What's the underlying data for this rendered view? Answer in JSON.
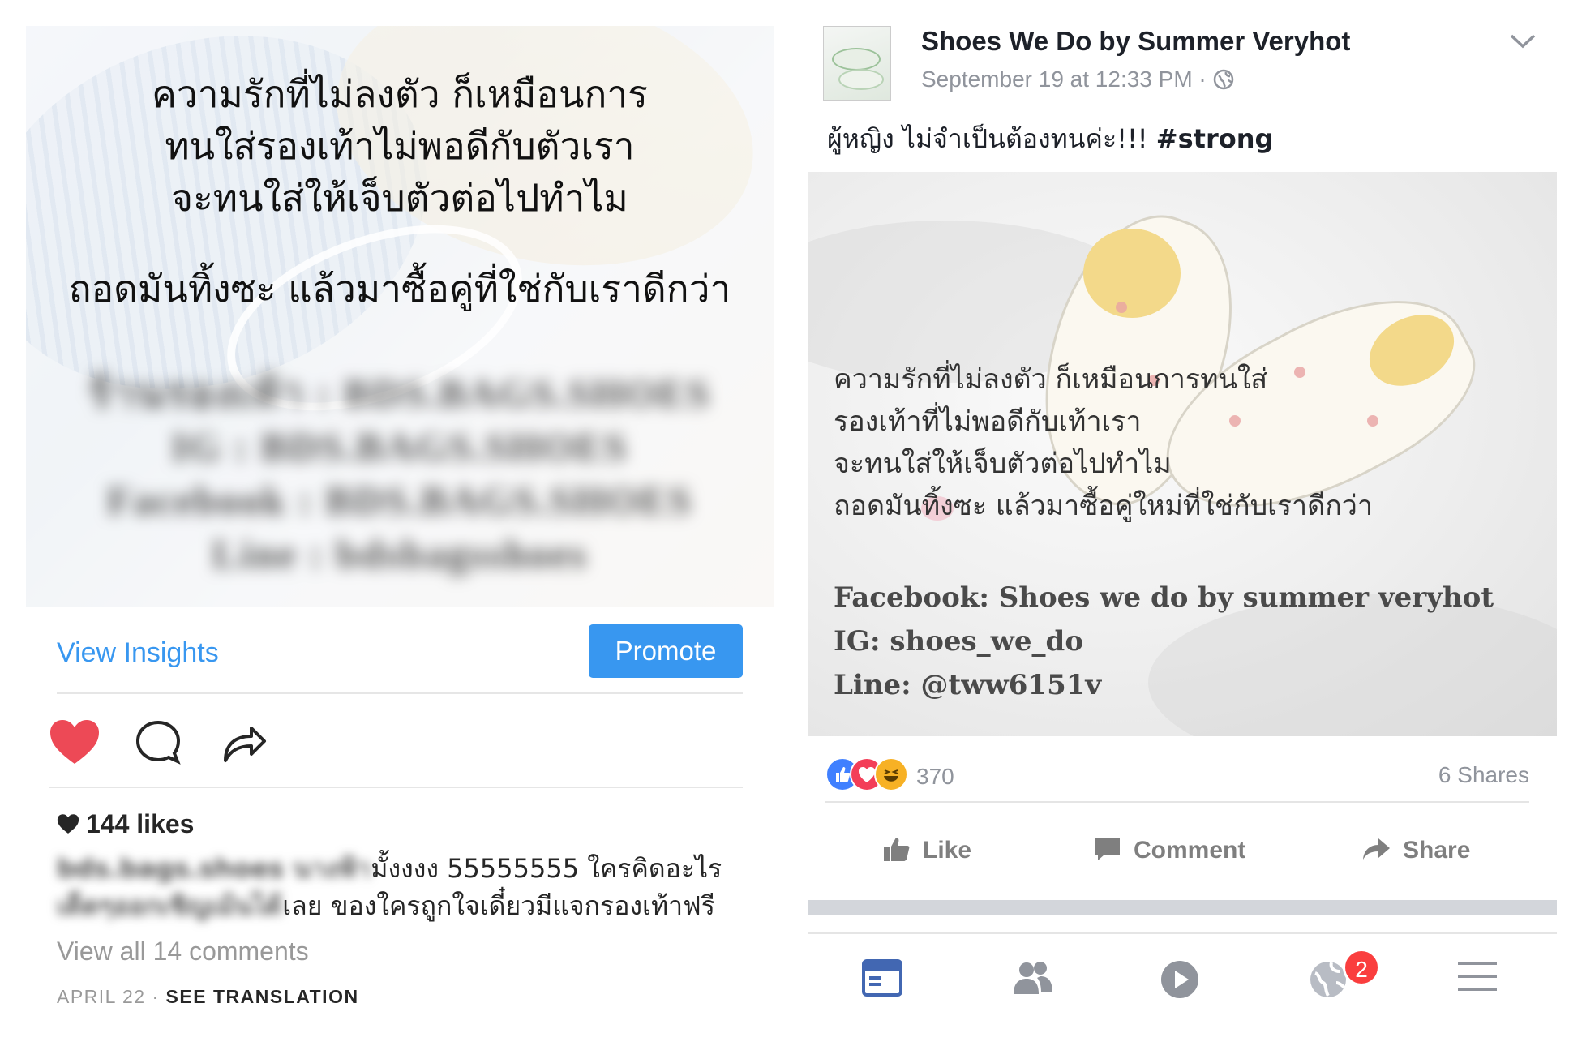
{
  "instagram": {
    "image_text": {
      "line1": "ความรักที่ไม่ลงตัว ก็เหมือนการ",
      "line2": "ทนใส่รองเท้าไม่พอดีกับตัวเรา",
      "line3": "จะทนใส่ให้เจ็บตัวต่อไปทำไม",
      "line4": "ถอดมันทิ้งซะ แล้วมาซื้อคู่ที่ใช่กับเราดีกว่า"
    },
    "blurred_lines": [
      "ร้านรองเท้า : BDS.BAGS.SHOES",
      "IG : BDS.BAGS.SHOES",
      "Facebook : BDS.BAGS.SHOES",
      "Line : bdsbagsshoes"
    ],
    "view_insights": "View Insights",
    "promote": "Promote",
    "likes": "144 likes",
    "caption_user_blurred": "bds.bags.shoes นางฟ้า",
    "caption_line1_rest": "มั้งงงง 55555555 ใครคิดอะไร",
    "caption_line2_blurred": "เด็ดๆออกเชิญเม้นได้",
    "caption_line2_rest": "เลย ของใครถูกใจเดี๋ยวมีแจกรองเท้าฟรี",
    "view_all_comments": "View all 14 comments",
    "date": "APRIL 22",
    "separator": " · ",
    "see_translation": "SEE TRANSLATION",
    "heart_color": "#ed4956"
  },
  "facebook": {
    "page_name": "Shoes We Do by Summer Veryhot",
    "timestamp": "September 19 at 12:33 PM · ",
    "post_text": "ผู้หญิง ไม่จำเป็นต้องทนค่ะ!!! ",
    "hashtag": "#strong",
    "image_quote": [
      "ความรักที่ไม่ลงตัว ก็เหมือนการทนใส่",
      "รองเท้าที่ไม่พอดีกับเท้าเรา",
      "จะทนใส่ให้เจ็บตัวต่อไปทำไม",
      "ถอดมันทิ้งซะ แล้วมาซื้อคู่ใหม่ที่ใช่กับเราดีกว่า"
    ],
    "image_contacts": [
      "Facebook: Shoes we do by summer veryhot",
      "IG: shoes_we_do",
      "Line: @tww6151v"
    ],
    "reaction_count": "370",
    "shares": "6 Shares",
    "actions": {
      "like": "Like",
      "comment": "Comment",
      "share": "Share"
    },
    "notification_badge": "2",
    "accent": "#4267b2"
  }
}
